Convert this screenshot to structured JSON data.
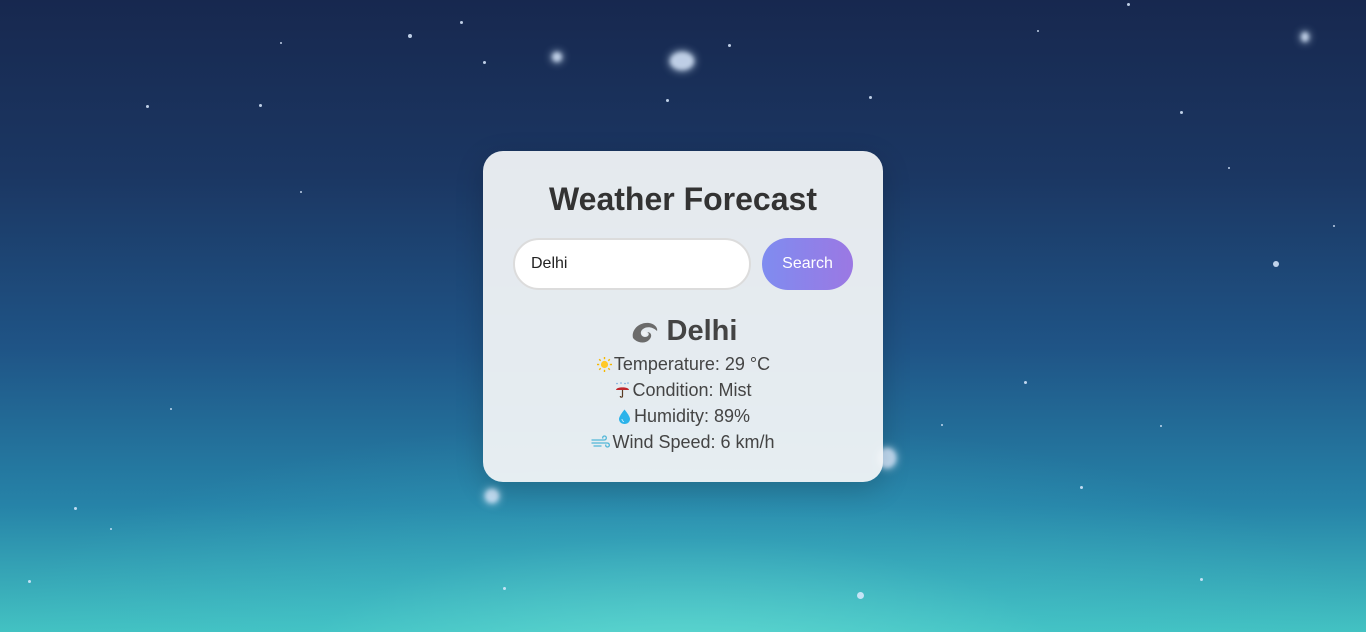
{
  "app": {
    "title": "Weather Forecast"
  },
  "search": {
    "value": "Delhi",
    "placeholder": "",
    "button_label": "Search"
  },
  "result": {
    "city": "Delhi",
    "city_icon": "cyclone-icon",
    "details": [
      {
        "icon": "sun-icon",
        "label": "Temperature: 29 °C"
      },
      {
        "icon": "umbrella-icon",
        "label": "Condition: Mist"
      },
      {
        "icon": "droplet-icon",
        "label": "Humidity: 89%"
      },
      {
        "icon": "wind-icon",
        "label": "Wind Speed: 6 km/h"
      }
    ]
  },
  "colors": {
    "background_top": "#17284f",
    "background_bottom": "#43c2c2",
    "card": "#f0f3f6",
    "button_start": "#7f8cf0",
    "button_end": "#9b78e3",
    "title_text": "#333333",
    "body_text": "#444444"
  }
}
